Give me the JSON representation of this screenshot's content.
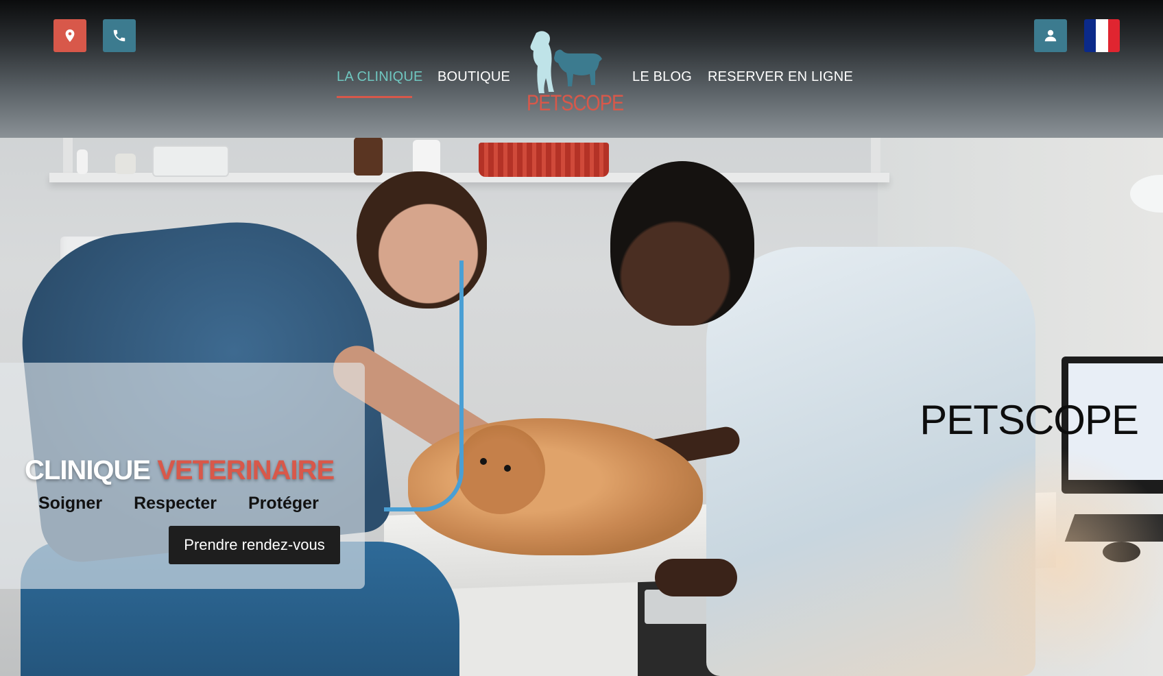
{
  "header": {
    "nav": {
      "clinique": "LA CLINIQUE",
      "boutique": "BOUTIQUE",
      "blog": "LE BLOG",
      "reserver": "RESERVER EN LIGNE"
    },
    "logo_text": "PETSCOPE",
    "icons": {
      "location": "map-pin-icon",
      "phone": "phone-icon",
      "account": "user-icon",
      "language": "french-flag-icon"
    },
    "active_nav_color": "#6fc7c0",
    "accent_color": "#d8584a",
    "button_teal": "#3c7b8f"
  },
  "hero": {
    "title": "PETSCOPE",
    "subtitle_part1": "CLINIQUE",
    "subtitle_part2": "VETERINAIRE",
    "values": [
      "Soigner",
      "Respecter",
      "Protéger"
    ],
    "cta_label": "Prendre rendez-vous"
  }
}
